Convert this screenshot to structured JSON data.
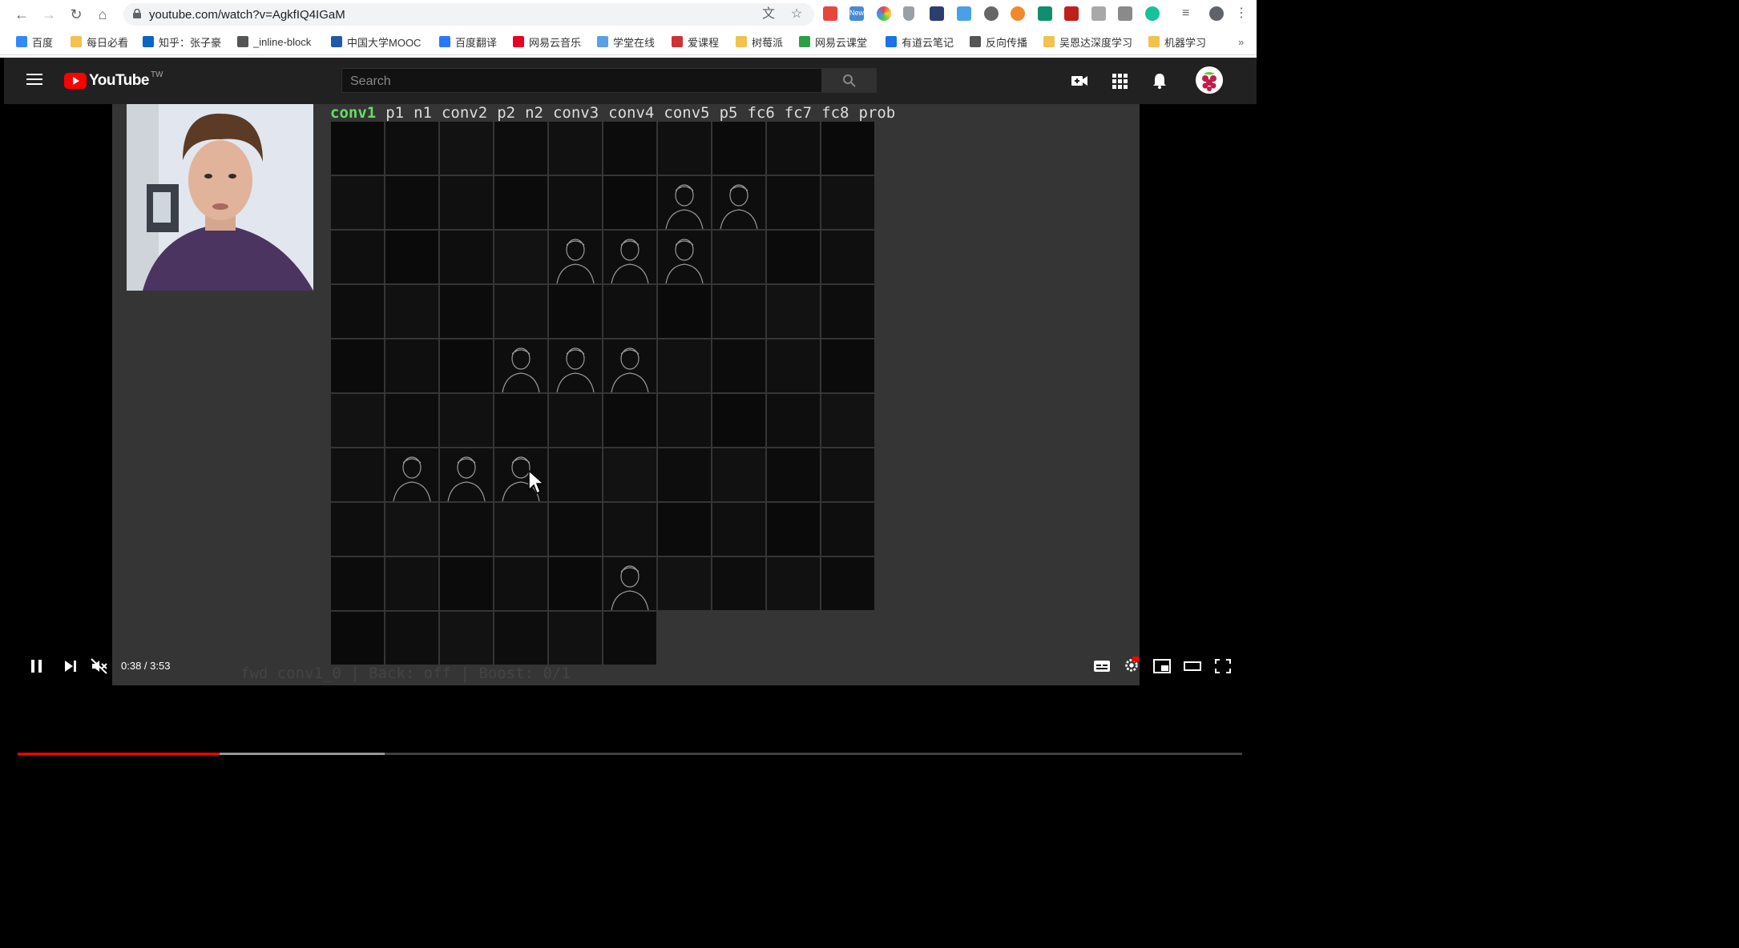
{
  "browser": {
    "url": "youtube.com/watch?v=AgkfIQ4IGaM",
    "extension_badge": "New",
    "bookmarks": [
      {
        "label": "百度",
        "color": "#3388ff"
      },
      {
        "label": "每日必看",
        "color": "#f2c14e"
      },
      {
        "label": "知乎：张子豪",
        "color": "#0a66c2"
      },
      {
        "label": "_inline-block",
        "color": "#555555"
      },
      {
        "label": "中国大学MOOC",
        "color": "#1e5aa8"
      },
      {
        "label": "百度翻译",
        "color": "#2979ff"
      },
      {
        "label": "网易云音乐",
        "color": "#e60026"
      },
      {
        "label": "学堂在线",
        "color": "#5aa0e6"
      },
      {
        "label": "爱课程",
        "color": "#cc3333"
      },
      {
        "label": "树莓派",
        "color": "#f2c14e"
      },
      {
        "label": "网易云课堂",
        "color": "#2e9e46"
      },
      {
        "label": "有道云笔记",
        "color": "#1a73e8"
      },
      {
        "label": "反向传播",
        "color": "#555555"
      },
      {
        "label": "吴恩达深度学习",
        "color": "#f2c14e"
      },
      {
        "label": "机器学习",
        "color": "#f2c14e"
      }
    ],
    "more": "»"
  },
  "youtube": {
    "logo_text": "YouTube",
    "country": "TW",
    "search_placeholder": "Search"
  },
  "video": {
    "layers": [
      "conv1",
      "p1",
      "n1",
      "conv2",
      "p2",
      "n2",
      "conv3",
      "conv4",
      "conv5",
      "p5",
      "fc6",
      "fc7",
      "fc8",
      "prob"
    ],
    "active_layer": "conv1",
    "status_line": "fwd conv1_0 | Back: off | Boost: 0/1",
    "time": "0:38 / 3:53",
    "progress_played": 0.165,
    "progress_buffered": 0.3
  },
  "colors": {
    "yt_header": "#212121",
    "yt_red": "#ff0000",
    "active_layer": "#66dd66"
  }
}
